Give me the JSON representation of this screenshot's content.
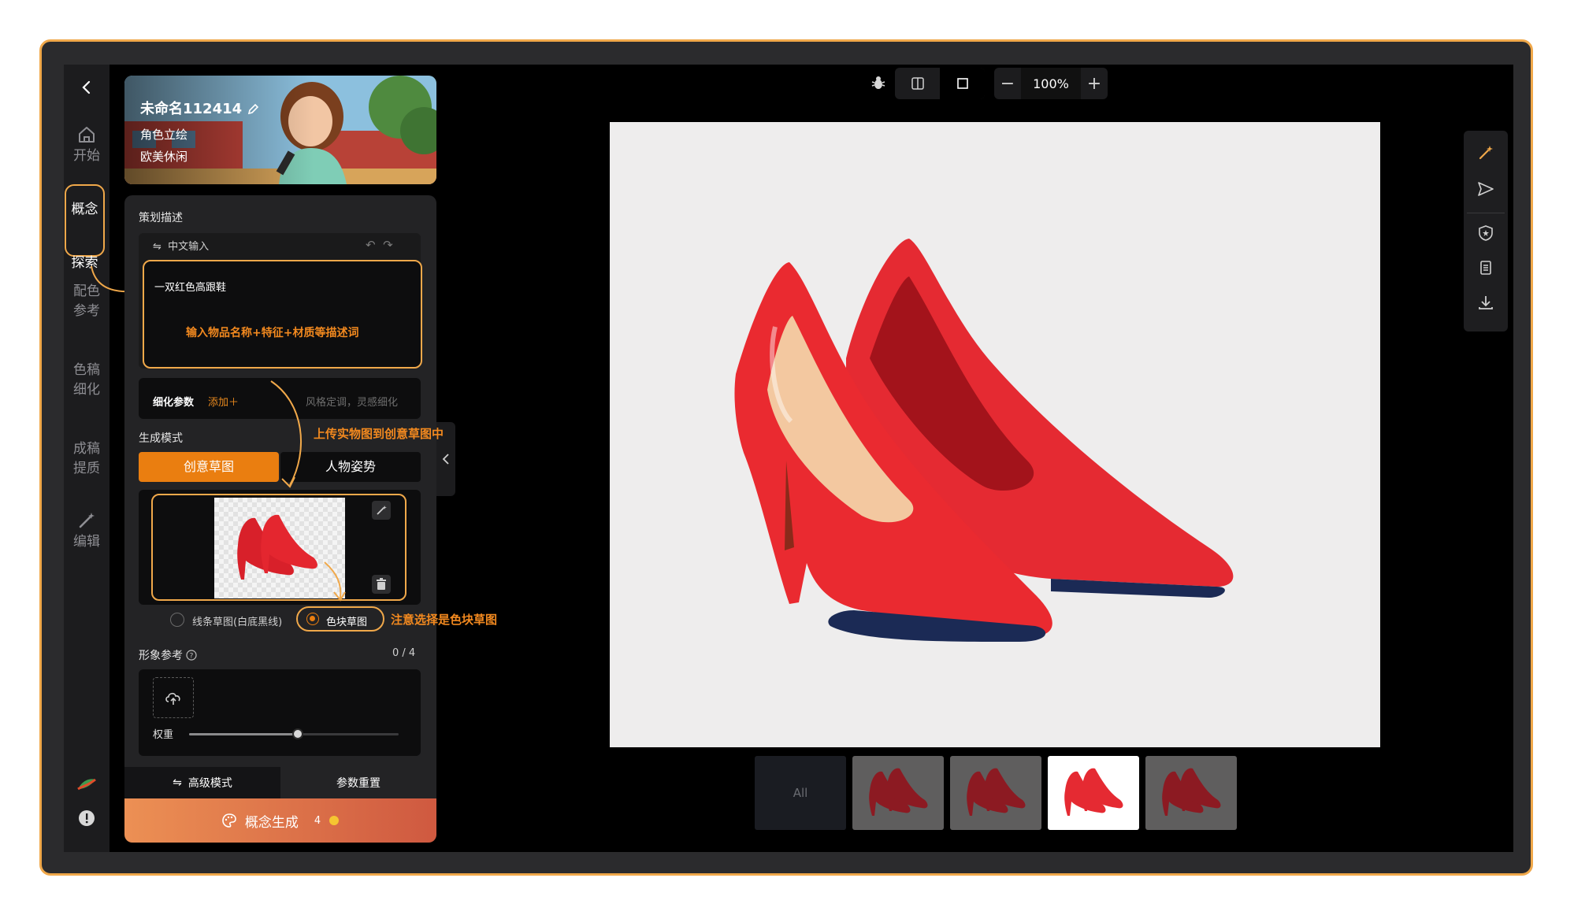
{
  "nav": {
    "back_label": "",
    "items": [
      {
        "label": "开始",
        "icon": "home-icon"
      },
      {
        "label": "概念探索",
        "line1": "概念",
        "line2": "探索",
        "icon": "",
        "active": true
      },
      {
        "label": "配色参考",
        "line1": "配色",
        "line2": "参考"
      },
      {
        "label": "色稿细化",
        "line1": "色稿",
        "line2": "细化"
      },
      {
        "label": "成稿提质",
        "line1": "成稿",
        "line2": "提质"
      },
      {
        "label": "编辑",
        "icon": "magic-wand-icon"
      }
    ]
  },
  "project": {
    "name": "未命名112414",
    "type": "角色立绘",
    "style": "欧美休闲"
  },
  "panel": {
    "description_title": "策划描述",
    "input_lang": "中文输入",
    "prompt_text": "一双红色高跟鞋",
    "prompt_hint": "输入物品名称+特征+材质等描述词",
    "refine_label": "细化参数",
    "refine_add": "添加＋",
    "refine_tags": "风格定调，灵感细化",
    "mode_title": "生成模式",
    "mode_tabs": [
      "创意草图",
      "人物姿势"
    ],
    "active_mode": "创意草图",
    "sketch_options": [
      "线条草图(白底黑线)",
      "色块草图"
    ],
    "selected_sketch": "色块草图",
    "ref_title": "形象参考",
    "ref_count": "0 / 4",
    "weight_label": "权重",
    "weight_value": 0.52,
    "advanced_mode": "高级模式",
    "reset_params": "参数重置",
    "generate_label": "概念生成",
    "generate_cost": "4"
  },
  "annotations": {
    "upload_hint": "上传实物图到创意草图中",
    "select_hint": "注意选择是色块草图"
  },
  "toolbar": {
    "zoom": "100%"
  },
  "thumbnails": {
    "all_label": "All",
    "count": 4,
    "selected_index": 2
  },
  "colors": {
    "accent": "#ea7e10",
    "highlight_outline": "#f0a84a",
    "shoe_red": "#e8242c"
  }
}
